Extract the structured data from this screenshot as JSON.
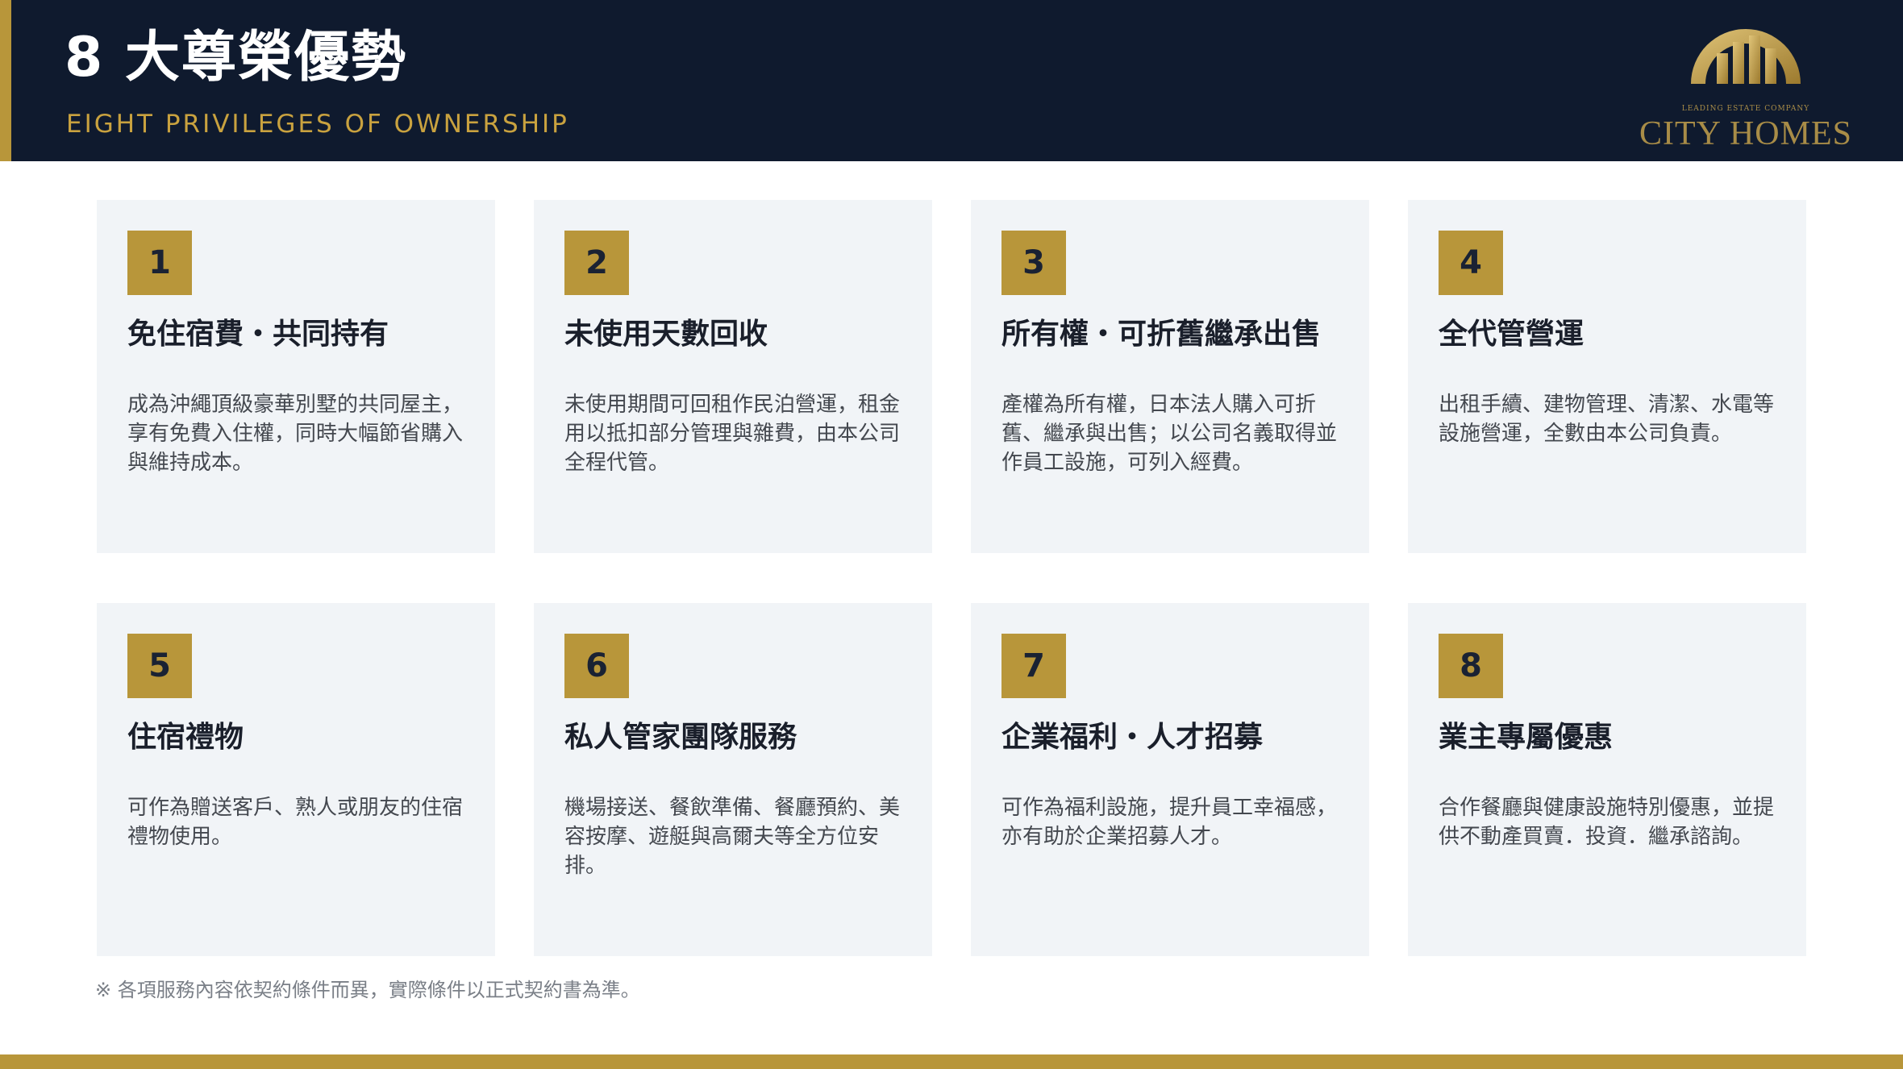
{
  "header": {
    "title": "8 大尊榮優勢",
    "subtitle": "EIGHT PRIVILEGES OF OWNERSHIP"
  },
  "logo": {
    "tagline": "LEADING ESTATE COMPANY",
    "name": "CITY HOMES"
  },
  "colors": {
    "navy": "#0f1a2e",
    "gold": "#b8963a",
    "card_bg": "#f1f4f7"
  },
  "cards": [
    {
      "number": "1",
      "title": "免住宿費・共同持有",
      "description": "成為沖繩頂級豪華別墅的共同屋主，享有免費入住權，同時大幅節省購入與維持成本。"
    },
    {
      "number": "2",
      "title": "未使用天數回收",
      "description": "未使用期間可回租作民泊營運，租金用以抵扣部分管理與雜費，由本公司全程代管。"
    },
    {
      "number": "3",
      "title": "所有權・可折舊繼承出售",
      "description": "產權為所有權，日本法人購入可折舊、繼承與出售；以公司名義取得並作員工設施，可列入經費。"
    },
    {
      "number": "4",
      "title": "全代管營運",
      "description": "出租手續、建物管理、清潔、水電等設施營運，全數由本公司負責。"
    },
    {
      "number": "5",
      "title": "住宿禮物",
      "description": "可作為贈送客戶、熟人或朋友的住宿禮物使用。"
    },
    {
      "number": "6",
      "title": "私人管家團隊服務",
      "description": "機場接送、餐飲準備、餐廳預約、美容按摩、遊艇與高爾夫等全方位安排。"
    },
    {
      "number": "7",
      "title": "企業福利・人才招募",
      "description": "可作為福利設施，提升員工幸福感，亦有助於企業招募人才。"
    },
    {
      "number": "8",
      "title": "業主專屬優惠",
      "description": "合作餐廳與健康設施特別優惠，並提供不動產買賣．投資．繼承諮詢。"
    }
  ],
  "footnote": "※ 各項服務內容依契約條件而異，實際條件以正式契約書為準。"
}
